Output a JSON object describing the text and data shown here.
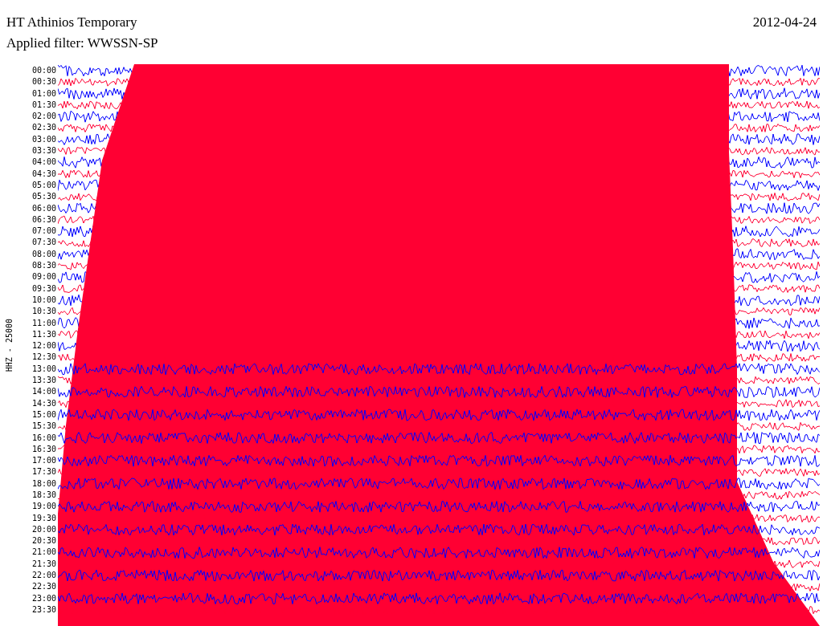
{
  "title": "HT Athinios Temporary",
  "filter": "Applied filter: WWSSN-SP",
  "date": "2012-04-24",
  "channel": "HHZ - 25000",
  "rows": [
    {
      "time": "00:00",
      "color": "#0000ff"
    },
    {
      "time": "00:30",
      "color": "#ff0033"
    },
    {
      "time": "01:00",
      "color": "#0000ff"
    },
    {
      "time": "01:30",
      "color": "#ff0033"
    },
    {
      "time": "02:00",
      "color": "#0000ff"
    },
    {
      "time": "02:30",
      "color": "#ff0033"
    },
    {
      "time": "03:00",
      "color": "#0000ff"
    },
    {
      "time": "03:30",
      "color": "#ff0033"
    },
    {
      "time": "04:00",
      "color": "#0000ff"
    },
    {
      "time": "04:30",
      "color": "#ff0033"
    },
    {
      "time": "05:00",
      "color": "#0000ff"
    },
    {
      "time": "05:30",
      "color": "#ff0033"
    },
    {
      "time": "06:00",
      "color": "#0000ff"
    },
    {
      "time": "06:30",
      "color": "#ff0033"
    },
    {
      "time": "07:00",
      "color": "#0000ff"
    },
    {
      "time": "07:30",
      "color": "#ff0033"
    },
    {
      "time": "08:00",
      "color": "#0000ff"
    },
    {
      "time": "08:30",
      "color": "#ff0033"
    },
    {
      "time": "09:00",
      "color": "#0000ff"
    },
    {
      "time": "09:30",
      "color": "#ff0033"
    },
    {
      "time": "10:00",
      "color": "#0000ff"
    },
    {
      "time": "10:30",
      "color": "#ff0033"
    },
    {
      "time": "11:00",
      "color": "#0000ff"
    },
    {
      "time": "11:30",
      "color": "#ff0033"
    },
    {
      "time": "12:00",
      "color": "#0000ff"
    },
    {
      "time": "12:30",
      "color": "#ff0033"
    },
    {
      "time": "13:00",
      "color": "#0000ff"
    },
    {
      "time": "13:30",
      "color": "#ff0033"
    },
    {
      "time": "14:00",
      "color": "#0000ff"
    },
    {
      "time": "14:30",
      "color": "#ff0033"
    },
    {
      "time": "15:00",
      "color": "#0000ff"
    },
    {
      "time": "15:30",
      "color": "#ff0033"
    },
    {
      "time": "16:00",
      "color": "#0000ff"
    },
    {
      "time": "16:30",
      "color": "#ff0033"
    },
    {
      "time": "17:00",
      "color": "#0000ff"
    },
    {
      "time": "17:30",
      "color": "#ff0033"
    },
    {
      "time": "18:00",
      "color": "#0000ff"
    },
    {
      "time": "18:30",
      "color": "#ff0033"
    },
    {
      "time": "19:00",
      "color": "#0000ff"
    },
    {
      "time": "19:30",
      "color": "#ff0033"
    },
    {
      "time": "20:00",
      "color": "#0000ff"
    },
    {
      "time": "20:30",
      "color": "#ff0033"
    },
    {
      "time": "21:00",
      "color": "#0000ff"
    },
    {
      "time": "21:30",
      "color": "#ff0033"
    },
    {
      "time": "22:00",
      "color": "#0000ff"
    },
    {
      "time": "22:30",
      "color": "#ff0033"
    },
    {
      "time": "23:00",
      "color": "#0000ff"
    },
    {
      "time": "23:30",
      "color": "#ff0033"
    }
  ]
}
